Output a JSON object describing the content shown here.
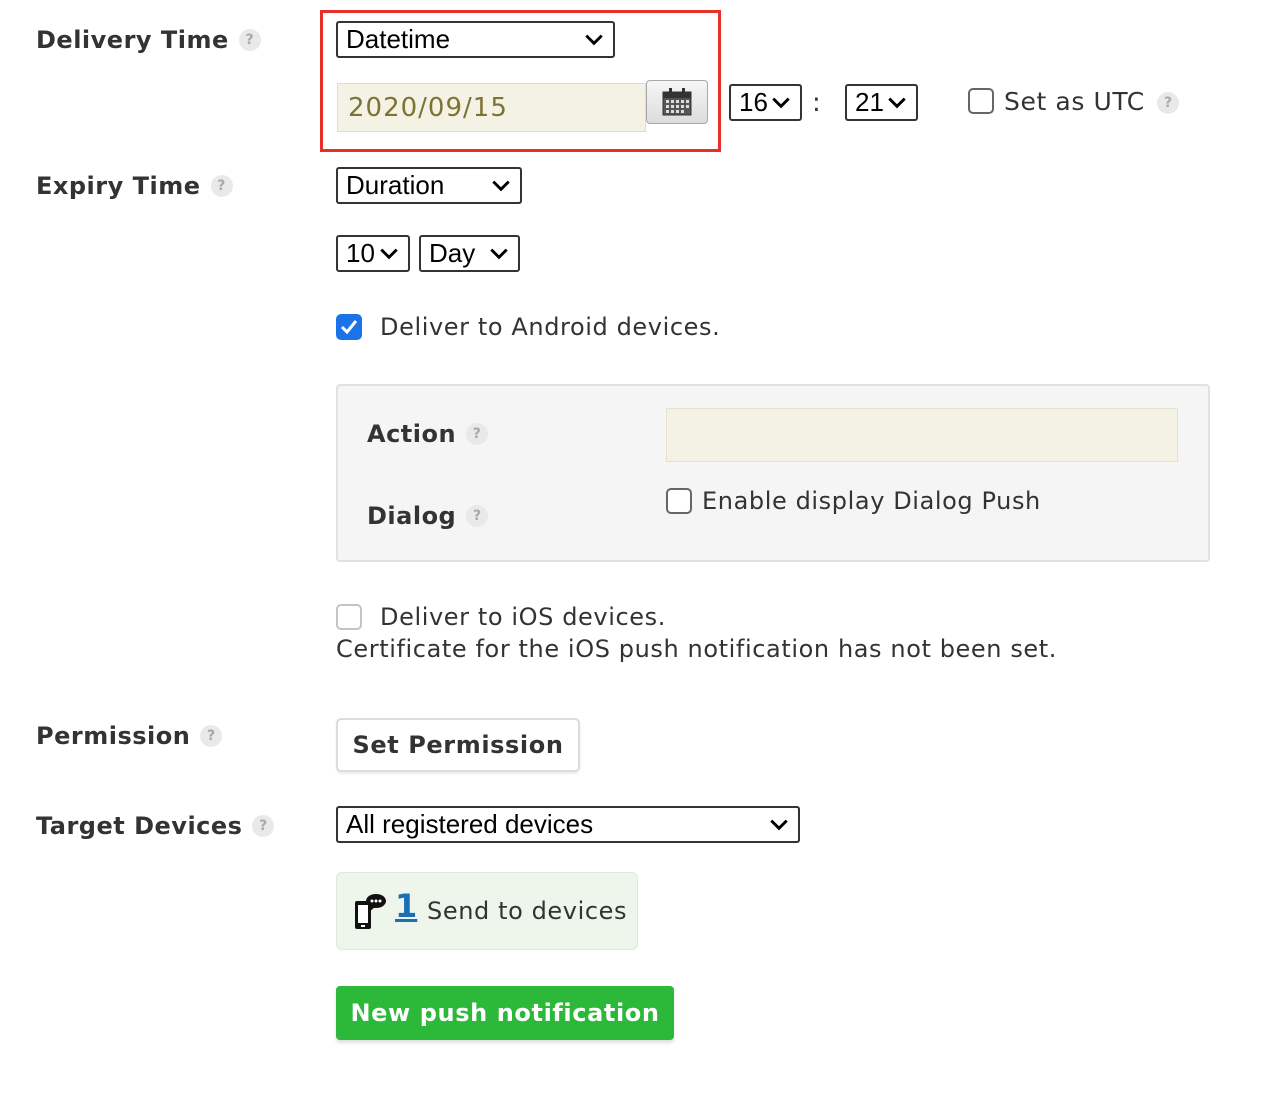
{
  "delivery_time": {
    "label": "Delivery Time",
    "help_glyph": "?",
    "mode_select": "Datetime",
    "date_value": "2020/09/15",
    "hour_select": "16",
    "time_separator": ":",
    "minute_select": "21",
    "set_as_utc_label": "Set as UTC",
    "set_as_utc_checked": false,
    "highlight_color": "#e8302a"
  },
  "expiry_time": {
    "label": "Expiry Time",
    "help_glyph": "?",
    "mode_select": "Duration",
    "amount_select": "10",
    "unit_select": "Day"
  },
  "android": {
    "deliver_label": "Deliver to Android devices.",
    "deliver_checked": true,
    "action_label": "Action",
    "action_value": "",
    "dialog_label": "Dialog",
    "dialog_option_label": "Enable display Dialog Push",
    "dialog_checked": false
  },
  "ios": {
    "deliver_label": "Deliver to iOS devices.",
    "deliver_checked": false,
    "note": "Certificate for the iOS push notification has not been set."
  },
  "permission": {
    "label": "Permission",
    "button_label": "Set Permission"
  },
  "target_devices": {
    "label": "Target Devices",
    "select_value": "All registered devices",
    "device_count": "1",
    "send_label": "Send to devices",
    "icon": "mobile-message-icon"
  },
  "submit": {
    "label": "New push notification",
    "color": "#2cb93a"
  },
  "colors": {
    "accent_blue": "#1a73e8",
    "link_blue": "#1a6fb5",
    "input_bg": "#f4f2e4"
  }
}
